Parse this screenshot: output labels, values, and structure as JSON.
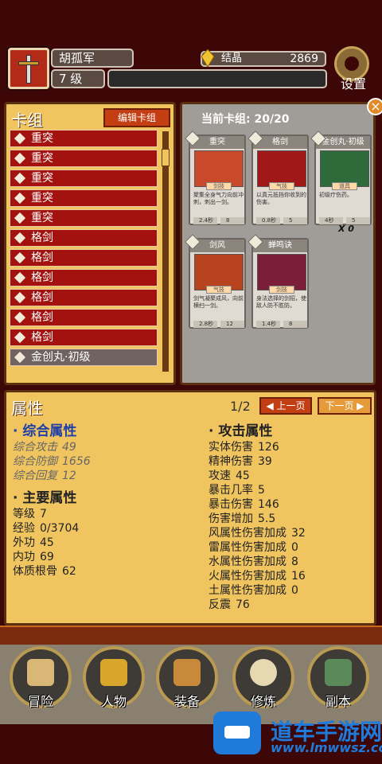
{
  "header": {
    "player_name": "胡孤军",
    "level": "7 级",
    "crystal_label": "结晶",
    "crystal_value": "2869",
    "settings_label": "设置"
  },
  "deck": {
    "title": "卡组",
    "edit_button": "编辑卡组",
    "items": [
      "重突",
      "重突",
      "重突",
      "重突",
      "重突",
      "格剑",
      "格剑",
      "格剑",
      "格剑",
      "格剑",
      "格剑",
      "金创丸·初级"
    ]
  },
  "current_deck": {
    "title": "当前卡组: 20/20",
    "extra_count": "X 0",
    "cards": [
      {
        "name": "重突",
        "tag": "剑技",
        "desc": "聚集全身气力向前冲刺，刺出一剑。",
        "stat_l": "2.4秒",
        "stat_r": "8"
      },
      {
        "name": "格剑",
        "tag": "气技",
        "desc": "以真元抵挡你收到的伤害。",
        "stat_l": "0.8秒",
        "stat_r": "5"
      },
      {
        "name": "金创丸·初级",
        "tag": "道具",
        "desc": "初级疗伤药。",
        "stat_l": "4秒",
        "stat_r": "5"
      },
      {
        "name": "剑风",
        "tag": "气技",
        "desc": "剑气凝聚成风，向前横扫一剑。",
        "stat_l": "2.8秒",
        "stat_r": "12"
      },
      {
        "name": "蝉鸣诀",
        "tag": "剑技",
        "desc": "身法选择的剑招，使敌人防不胜防。",
        "stat_l": "1.4秒",
        "stat_r": "8"
      }
    ]
  },
  "attributes": {
    "title": "属性",
    "page": "1/2",
    "prev": "上一页",
    "next": "下一页",
    "combined_title": "· 综合属性",
    "combined": [
      {
        "k": "综合攻击",
        "v": "49"
      },
      {
        "k": "综合防御",
        "v": "1656"
      },
      {
        "k": "综合回复",
        "v": "12"
      }
    ],
    "main_title": "· 主要属性",
    "main": [
      {
        "k": "等级",
        "v": "7"
      },
      {
        "k": "经验",
        "v": "0/3704"
      },
      {
        "k": "外功",
        "v": "45"
      },
      {
        "k": "内功",
        "v": "69"
      },
      {
        "k": "体质根骨",
        "v": "62"
      }
    ],
    "attack_title": "· 攻击属性",
    "attack": [
      {
        "k": "实体伤害",
        "v": "126"
      },
      {
        "k": "精神伤害",
        "v": "39"
      },
      {
        "k": "攻速",
        "v": "45"
      },
      {
        "k": "暴击几率",
        "v": "5"
      },
      {
        "k": "暴击伤害",
        "v": "146"
      },
      {
        "k": "伤害增加",
        "v": "5.5"
      },
      {
        "k": "风属性伤害加成",
        "v": "32"
      },
      {
        "k": "雷属性伤害加成",
        "v": "0"
      },
      {
        "k": "水属性伤害加成",
        "v": "8"
      },
      {
        "k": "火属性伤害加成",
        "v": "16"
      },
      {
        "k": "土属性伤害加成",
        "v": "0"
      },
      {
        "k": "反震",
        "v": "76"
      }
    ]
  },
  "nav": [
    "冒险",
    "人物",
    "装备",
    "修炼",
    "副本"
  ],
  "watermark": {
    "title": "道车手游网",
    "url": "www.lmwwsz.com"
  }
}
